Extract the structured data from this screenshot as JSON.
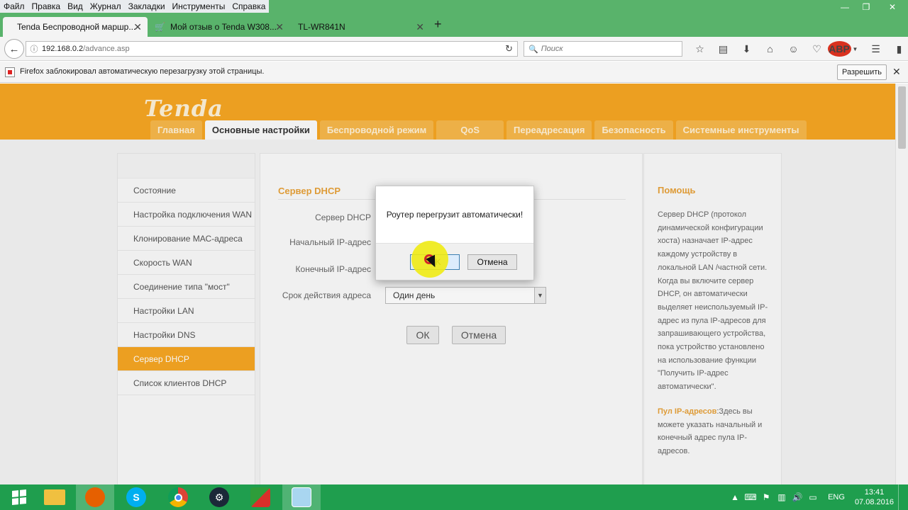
{
  "menu": [
    "Файл",
    "Правка",
    "Вид",
    "Журнал",
    "Закладки",
    "Инструменты",
    "Справка"
  ],
  "window_controls": {
    "minimize": "—",
    "restore": "❐",
    "close": "✕"
  },
  "tabs": [
    {
      "title": "Tenda Беспроводной маршр..."
    },
    {
      "title": "Мой отзыв о Tenda W308..."
    },
    {
      "title": "TL-WR841N"
    }
  ],
  "toolbar": {
    "url_host": "192.168.0.2",
    "url_path": "/advance.asp",
    "search_placeholder": "Поиск",
    "abp_label": "ABP"
  },
  "notification": {
    "text": "Firefox заблокировал автоматическую перезагрузку этой страницы.",
    "allow_label": "Разрешить"
  },
  "router": {
    "logo": "Tenda",
    "nav": [
      "Главная",
      "Основные настройки",
      "Беспроводной режим",
      "QoS",
      "Переадресация",
      "Безопасность",
      "Системные инструменты"
    ],
    "sidebar": [
      "Состояние",
      "Настройка подключения WAN",
      "Клонирование МАС-адреса",
      "Скорость WAN",
      "Соединение типа \"мост\"",
      "Настройки LAN",
      "Настройки DNS",
      "Сервер DHCP",
      "Список клиентов DHCP"
    ],
    "content_title": "Сервер DHCP",
    "labels": {
      "dhcp_server": "Сервер DHCP",
      "start_ip": "Начальный IP-адрес",
      "end_ip": "Конечный IP-адрес",
      "lease": "Срок действия адреса"
    },
    "lease_value": "Один день",
    "ok_label": "ОК",
    "cancel_label": "Отмена",
    "help_title": "Помощь",
    "help_text": "Сервер DHCP (протокол динамической конфигурации хоста) назначает IP-адрес каждому устройству в локальной LAN /частной сети. Когда вы включите сервер DHCP, он автоматически выделяет неиспользуемый IP-адрес из пула IP-адресов для запрашивающего устройства, пока устройство установлено на использование функции \"Получить IP-адрес автоматически\".",
    "help_pool_label": "Пул IP-адресов",
    "help_pool_text": ":Здесь вы можете указать начальный и конечный адрес пула IP-адресов."
  },
  "dialog": {
    "message": "Роутер перегрузит автоматически!",
    "ok_label": "OK",
    "cancel_label": "Отмена"
  },
  "taskbar": {
    "apps": [
      "start",
      "file-explorer",
      "firefox",
      "skype",
      "chrome",
      "steam",
      "app-green-red",
      "app-notepad"
    ],
    "lang": "ENG",
    "time": "13:41",
    "date": "07.08.2016"
  }
}
